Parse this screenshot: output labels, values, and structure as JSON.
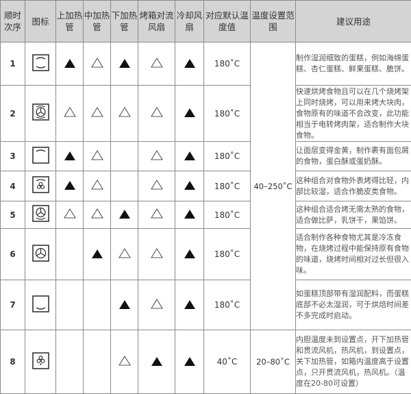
{
  "header": {
    "seq": "顺时次序",
    "icon": "图标",
    "top_heater": "上加热管",
    "mid_heater": "中加热管",
    "bottom_heater": "下加热管",
    "convection_fan": "烤箱对流风扇",
    "cooling_fan": "冷却风扇",
    "default_temp": "对应默认温度值",
    "temp_range": "温度设置范围",
    "usage": "建议用途"
  },
  "legend": {
    "on": "filled-triangle",
    "optional": "outline-triangle",
    "off": "empty"
  },
  "range_groups": [
    "40–250˚C",
    "20–80˚C"
  ],
  "rows": [
    {
      "seq": "1",
      "icon": "top-bottom-heat-icon",
      "top": "on",
      "mid": "optional",
      "bottom": "on",
      "conv": "optional",
      "cool": "on",
      "temp": "180˚C",
      "usage": "制作湿润细致的蛋糕，例如海绵蛋糕、杏仁蛋糕、鲜果蛋糕、脆饼。"
    },
    {
      "seq": "2",
      "icon": "convection-fan-full-heat-icon",
      "top": "optional",
      "mid": "optional",
      "bottom": "optional",
      "conv": "optional",
      "cool": "on",
      "temp": "180˚C",
      "usage": "快速烘烤食物且可以在几个烧烤架上同时烧烤，可以用来烤大块肉，食物原有的味道不会改变，此功能相当于电转烤肉架，适合制作大块食物。"
    },
    {
      "seq": "3",
      "icon": "top-heat-icon",
      "top": "on",
      "mid": "optional",
      "bottom": "off",
      "conv": "optional",
      "cool": "on",
      "temp": "180˚C",
      "usage": "让面层变得金黄，制作裹有面包屑的食物，蛋白酥或蛋奶酥。"
    },
    {
      "seq": "4",
      "icon": "top-heat-fan-icon",
      "top": "on",
      "mid": "optional",
      "bottom": "off",
      "conv": "optional",
      "cool": "on",
      "temp": "180˚C",
      "usage": "这种组合对食物外表烤得比轻，内部比较湿，适合作脆皮类食物。"
    },
    {
      "seq": "5",
      "icon": "bottom-heat-convection-icon",
      "top": "optional",
      "mid": "optional",
      "bottom": "on",
      "conv": "optional",
      "cool": "on",
      "temp": "180˚C",
      "usage": "这种组合适合烤无需太熟的食物，适合做比萨，乳饼干，果馅饼。"
    },
    {
      "seq": "6",
      "icon": "convection-fan-icon",
      "top": "off",
      "mid": "on",
      "bottom": "optional",
      "conv": "optional",
      "cool": "on",
      "temp": "180˚C",
      "usage": "适合制作各种食物尤其是冷冻食物，在烧烤过程中能保持原有食物的味道，烧烤时间相对过长但很入味。"
    },
    {
      "seq": "7",
      "icon": "bottom-heat-icon",
      "top": "off",
      "mid": "off",
      "bottom": "on",
      "conv": "optional",
      "cool": "on",
      "temp": "180˚C",
      "usage": "如蛋糕顶部带有湿润配料，而蛋糕底部不必太湿润，可于烘焙时间差不多完成时启动。"
    },
    {
      "seq": "8",
      "icon": "fan-defrost-icon",
      "top": "off",
      "mid": "off",
      "bottom": "optional",
      "conv": "on",
      "cool": "on",
      "temp": "40˚C",
      "usage": "内胆温度未到设置点，开下加热管和贯流风机，热风机，到设置点，关下加热管，如箱内温度高于设置点，只开贯流风机，热风机。（温度在20-80可设置）"
    }
  ]
}
